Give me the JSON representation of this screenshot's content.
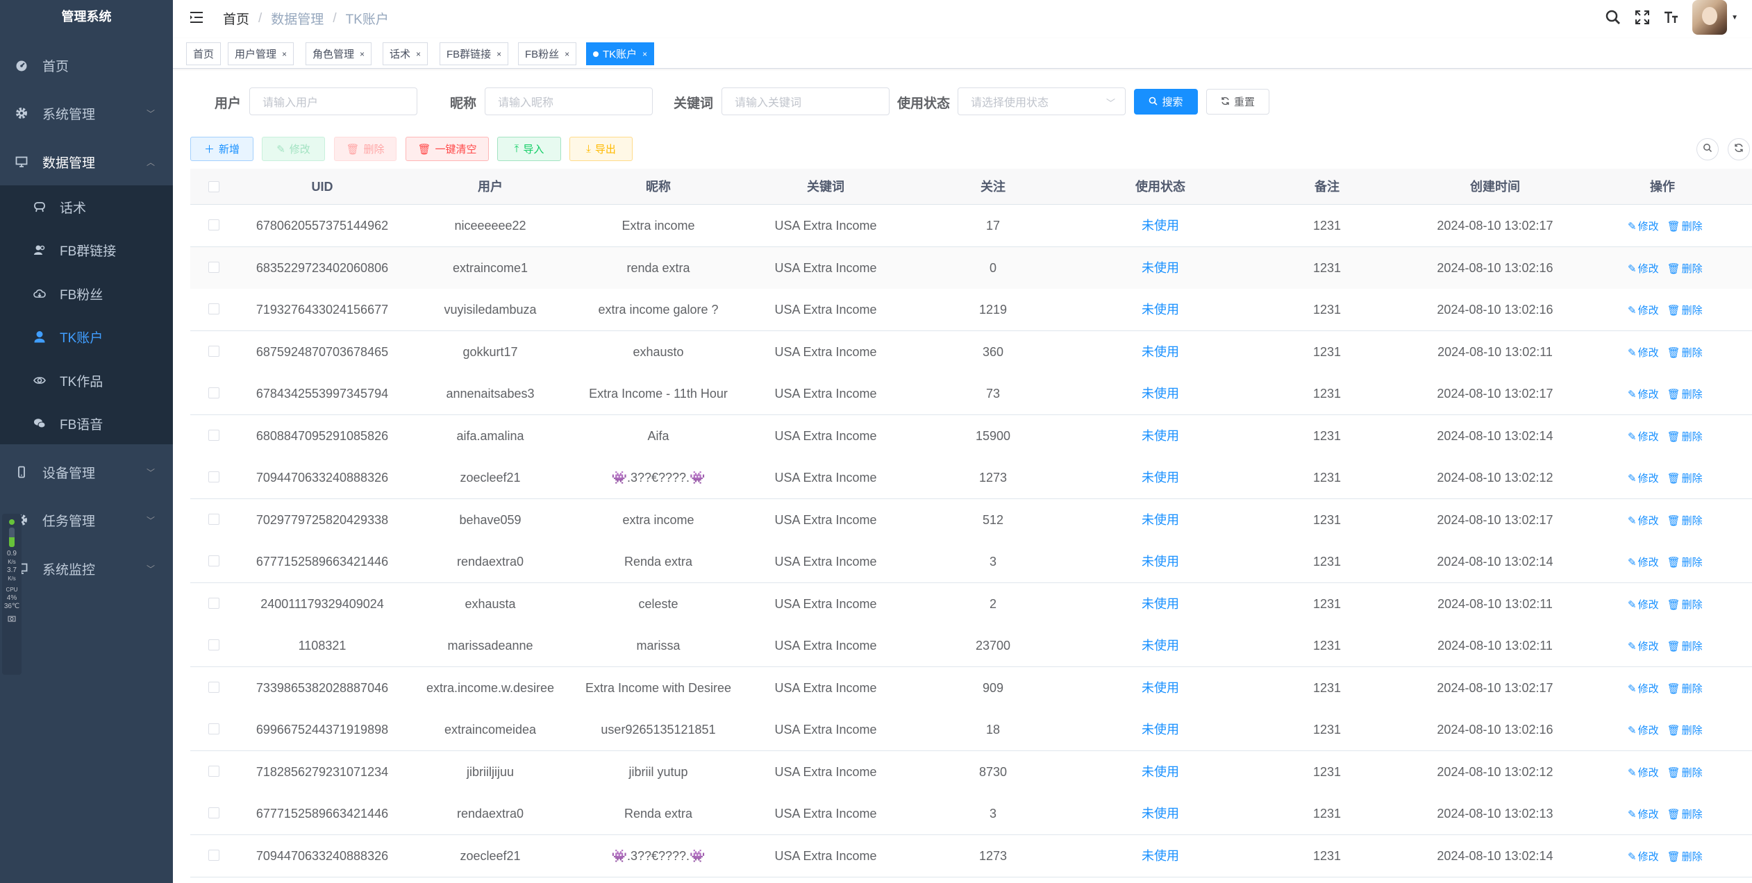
{
  "app": {
    "title": "管理系统"
  },
  "sidebar": {
    "items": [
      {
        "label": "首页",
        "icon": "dashboard-icon"
      },
      {
        "label": "系统管理",
        "icon": "gear-icon"
      },
      {
        "label": "数据管理",
        "icon": "monitor-icon"
      },
      {
        "label": "设备管理",
        "icon": "phone-icon"
      },
      {
        "label": "任务管理",
        "icon": "gear-icon"
      },
      {
        "label": "系统监控",
        "icon": "monitor-icon"
      }
    ],
    "sub_items": [
      {
        "label": "话术",
        "icon": "chat-icon"
      },
      {
        "label": "FB群链接",
        "icon": "users-icon"
      },
      {
        "label": "FB粉丝",
        "icon": "cloud-icon"
      },
      {
        "label": "TK账户",
        "icon": "user-icon",
        "active": true
      },
      {
        "label": "TK作品",
        "icon": "eye-icon"
      },
      {
        "label": "FB语音",
        "icon": "wechat-icon"
      }
    ]
  },
  "monitor": {
    "net1": "0.9",
    "net1_unit": "K/s",
    "net2": "3.7",
    "net2_unit": "K/s",
    "cpu_label": "CPU",
    "cpu": "4%",
    "temp": "36℃"
  },
  "breadcrumb": {
    "home": "首页",
    "section": "数据管理",
    "current": "TK账户"
  },
  "tags": [
    {
      "label": "首页",
      "closable": false
    },
    {
      "label": "用户管理",
      "closable": true
    },
    {
      "label": "角色管理",
      "closable": true
    },
    {
      "label": "话术",
      "closable": true
    },
    {
      "label": "FB群链接",
      "closable": true
    },
    {
      "label": "FB粉丝",
      "closable": true
    },
    {
      "label": "TK账户",
      "closable": true,
      "active": true
    }
  ],
  "search": {
    "user_label": "用户",
    "user_placeholder": "请输入用户",
    "nickname_label": "昵称",
    "nickname_placeholder": "请输入昵称",
    "keyword_label": "关键词",
    "keyword_placeholder": "请输入关键词",
    "status_label": "使用状态",
    "status_placeholder": "请选择使用状态",
    "search_button": "搜索",
    "reset_button": "重置"
  },
  "toolbar": {
    "add": "新增",
    "edit": "修改",
    "delete": "删除",
    "clear_all": "一键清空",
    "import": "导入",
    "export": "导出"
  },
  "table": {
    "columns": [
      "UID",
      "用户",
      "昵称",
      "关键词",
      "关注",
      "使用状态",
      "备注",
      "创建时间",
      "操作"
    ],
    "op_edit": "修改",
    "op_delete": "删除",
    "rows": [
      [
        "6780620557375144962",
        "niceeeeee22",
        "Extra income",
        "USA Extra Income",
        "17",
        "未使用",
        "1231",
        "2024-08-10 13:02:17"
      ],
      [
        "6835229723402060806",
        "extraincome1",
        "renda extra",
        "USA Extra Income",
        "0",
        "未使用",
        "1231",
        "2024-08-10 13:02:16"
      ],
      [
        "7193276433024156677",
        "vuyisiledambuza",
        "extra income galore ?",
        "USA Extra Income",
        "1219",
        "未使用",
        "1231",
        "2024-08-10 13:02:16"
      ],
      [
        "6875924870703678465",
        "gokkurt17",
        "exhausto",
        "USA Extra Income",
        "360",
        "未使用",
        "1231",
        "2024-08-10 13:02:11"
      ],
      [
        "6784342553997345794",
        "annenaitsabes3",
        "Extra Income - 11th Hour",
        "USA Extra Income",
        "73",
        "未使用",
        "1231",
        "2024-08-10 13:02:17"
      ],
      [
        "6808847095291085826",
        "aifa.amalina",
        "Aifa",
        "USA Extra Income",
        "15900",
        "未使用",
        "1231",
        "2024-08-10 13:02:14"
      ],
      [
        "7094470633240888326",
        "zoecleef21",
        "👾.3??€????.👾",
        "USA Extra Income",
        "1273",
        "未使用",
        "1231",
        "2024-08-10 13:02:12"
      ],
      [
        "7029779725820429338",
        "behave059",
        "extra income",
        "USA Extra Income",
        "512",
        "未使用",
        "1231",
        "2024-08-10 13:02:17"
      ],
      [
        "6777152589663421446",
        "rendaextra0",
        "Renda extra",
        "USA Extra Income",
        "3",
        "未使用",
        "1231",
        "2024-08-10 13:02:14"
      ],
      [
        "240011179329409024",
        "exhausta",
        "celeste",
        "USA Extra Income",
        "2",
        "未使用",
        "1231",
        "2024-08-10 13:02:11"
      ],
      [
        "1108321",
        "marissadeanne",
        "marissa",
        "USA Extra Income",
        "23700",
        "未使用",
        "1231",
        "2024-08-10 13:02:11"
      ],
      [
        "7339865382028887046",
        "extra.income.w.desiree",
        "Extra Income with Desiree",
        "USA Extra Income",
        "909",
        "未使用",
        "1231",
        "2024-08-10 13:02:17"
      ],
      [
        "6996675244371919898",
        "extraincomeidea",
        "user9265135121851",
        "USA Extra Income",
        "18",
        "未使用",
        "1231",
        "2024-08-10 13:02:16"
      ],
      [
        "7182856279231071234",
        "jibriiljijuu",
        "jibriil yutup",
        "USA Extra Income",
        "8730",
        "未使用",
        "1231",
        "2024-08-10 13:02:12"
      ],
      [
        "6777152589663421446",
        "rendaextra0",
        "Renda extra",
        "USA Extra Income",
        "3",
        "未使用",
        "1231",
        "2024-08-10 13:02:13"
      ],
      [
        "7094470633240888326",
        "zoecleef21",
        "👾.3??€????.👾",
        "USA Extra Income",
        "1273",
        "未使用",
        "1231",
        "2024-08-10 13:02:14"
      ]
    ]
  }
}
